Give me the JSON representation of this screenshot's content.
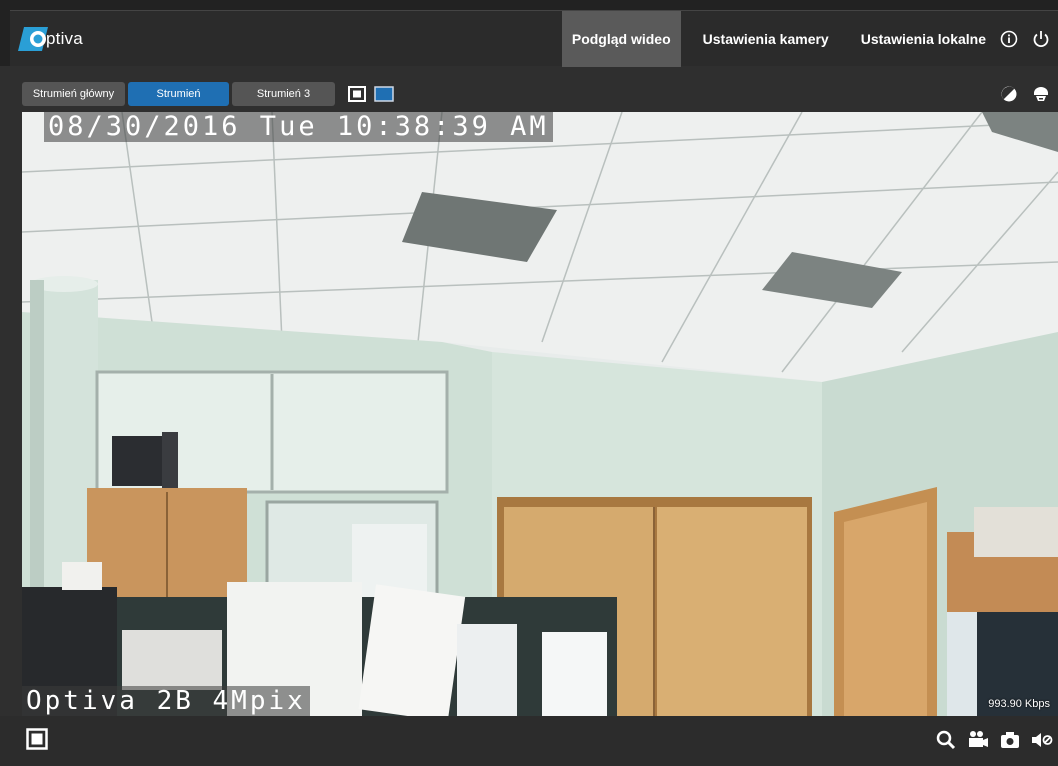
{
  "app": {
    "logo_text": "ptiva",
    "brand_color": "#2a9fd6"
  },
  "nav": {
    "items": [
      {
        "label": "Podgląd wideo",
        "active": true
      },
      {
        "label": "Ustawienia kamery",
        "active": false
      },
      {
        "label": "Ustawienia lokalne",
        "active": false
      }
    ],
    "icons": [
      "info-icon",
      "power-icon"
    ]
  },
  "toolbar": {
    "tabs": [
      {
        "label": "Strumień główny",
        "active": false
      },
      {
        "label": "Strumień",
        "active": true
      },
      {
        "label": "Strumień 3",
        "active": false
      }
    ],
    "layout_icons": [
      "single-view-icon",
      "fit-view-icon"
    ],
    "right_icons": [
      "contrast-icon",
      "ptz-icon"
    ],
    "active_color": "#1f6fb3"
  },
  "video": {
    "osd_time": "08/30/2016 Tue 10:38:39 AM",
    "osd_name": "Optiva 2B 4Mpix",
    "bitrate": "993.90 Kbps"
  },
  "bottom": {
    "left_icon": "fullscreen-icon",
    "right_icons": [
      "zoom-icon",
      "record-icon",
      "snapshot-icon",
      "mute-icon"
    ]
  }
}
